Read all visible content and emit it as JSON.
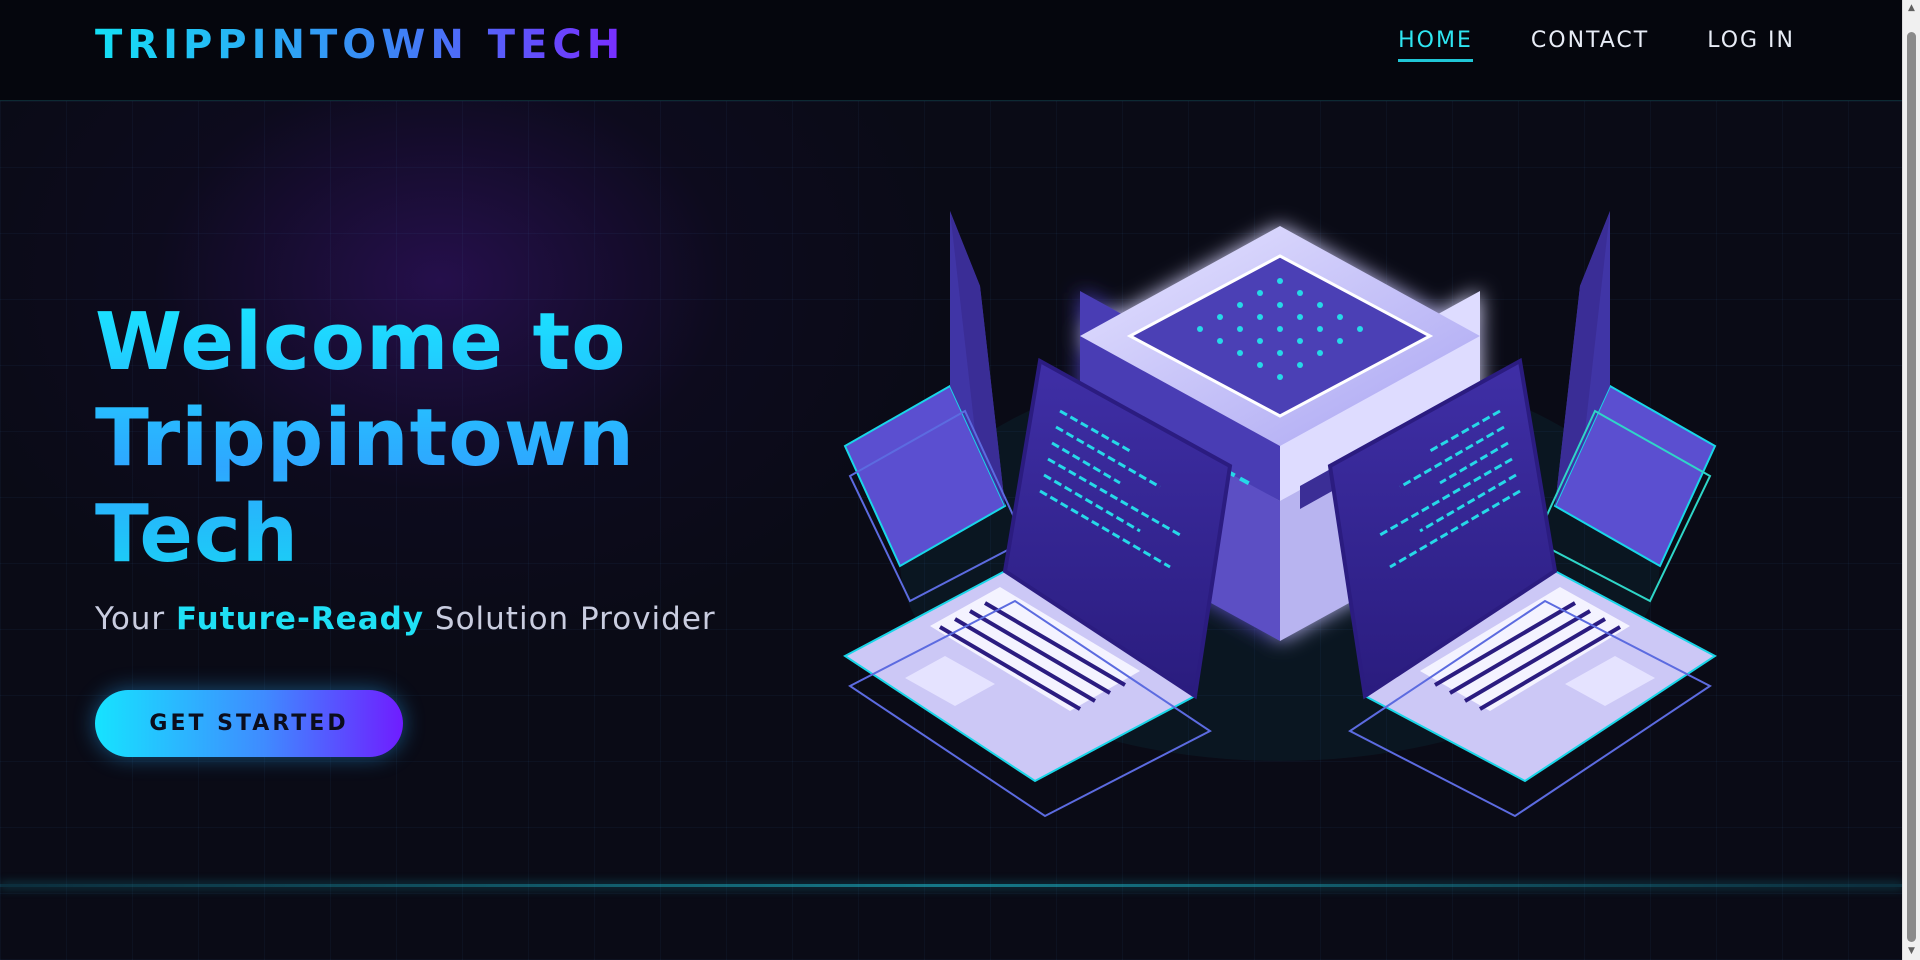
{
  "header": {
    "logo": "TRIPPINTOWN TECH",
    "nav": [
      {
        "label": "HOME",
        "active": true
      },
      {
        "label": "CONTACT",
        "active": false
      },
      {
        "label": "LOG IN",
        "active": false
      }
    ]
  },
  "hero": {
    "headline": "Welcome to Trippintown Tech",
    "tagline_prefix": "Your",
    "tagline_highlight": "Future-Ready",
    "tagline_suffix": "Solution Provider",
    "cta_label": "GET STARTED",
    "illustration_icon": "isometric-server-laptops-illustration"
  },
  "colors": {
    "accent_cyan": "#1fe0f5",
    "accent_purple": "#6f1dff",
    "background": "#0a0b16",
    "nav_background": "#05060d"
  }
}
